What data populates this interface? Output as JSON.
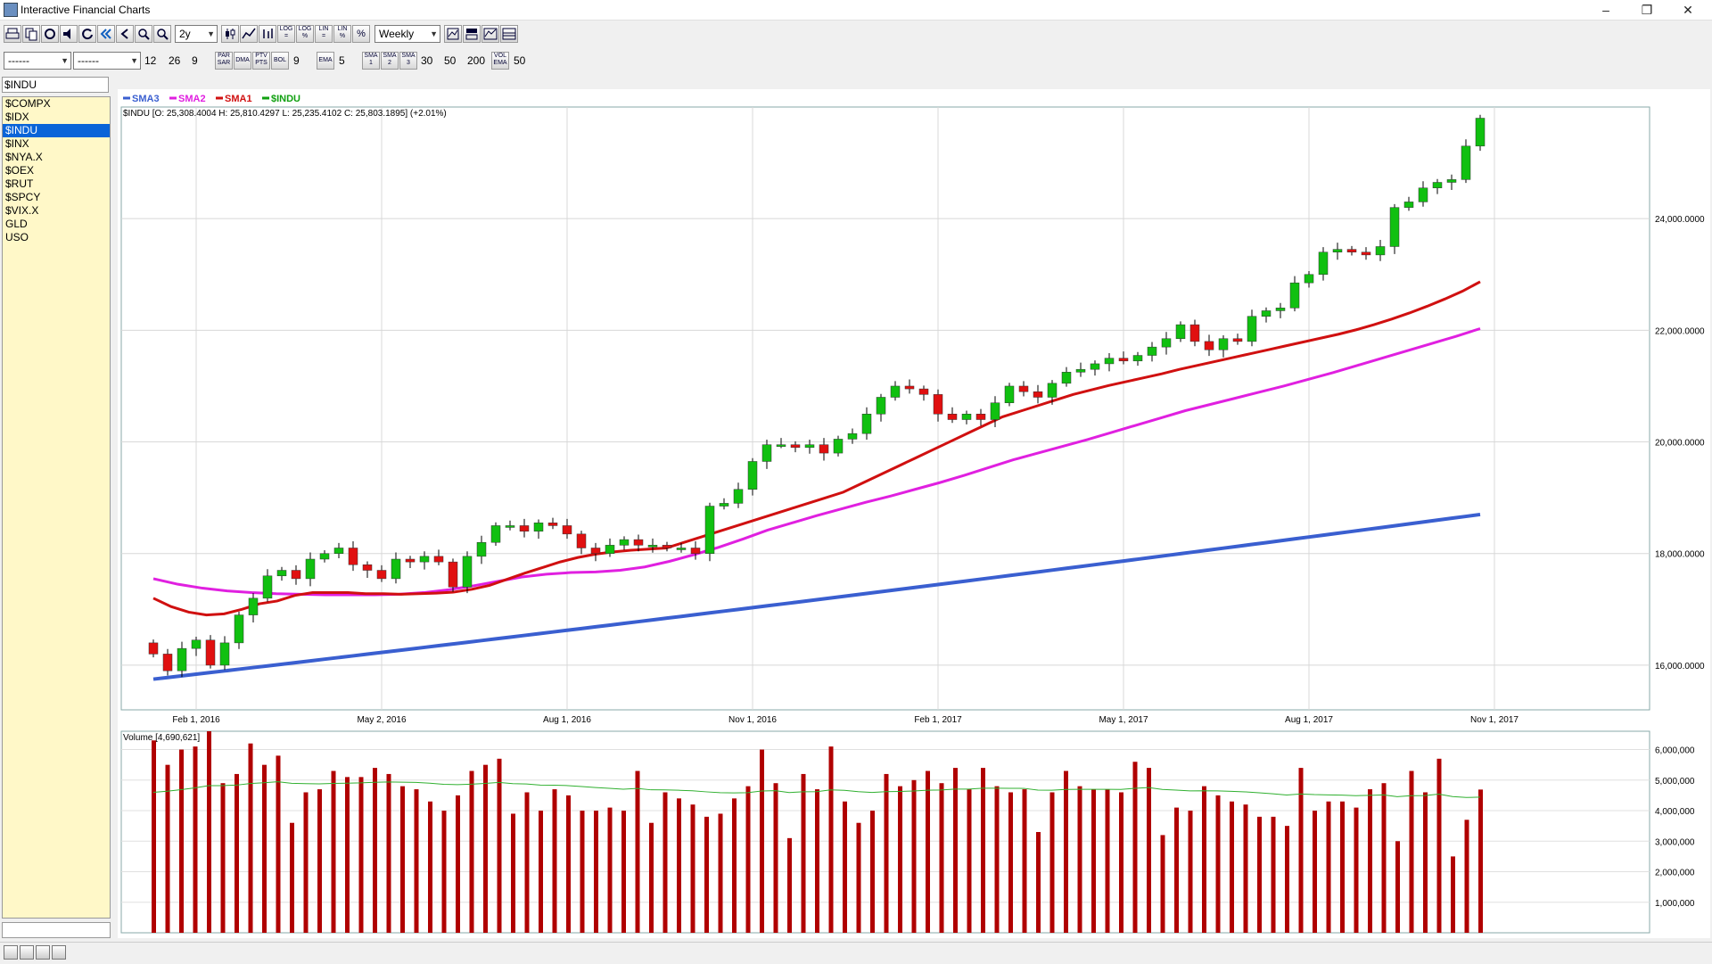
{
  "window": {
    "title": "Interactive Financial Charts"
  },
  "toolbar": {
    "period": "2y",
    "interval": "Weekly",
    "btn_log1": "LOG",
    "btn_log2": "LOG",
    "btn_lin1": "LIN",
    "btn_lin2": "LIN",
    "btn_pct": "%"
  },
  "toolbar2": {
    "combo1": "------",
    "combo2": "------",
    "macd_fast": "12",
    "macd_slow": "26",
    "macd_signal": "9",
    "btn_par": "PAR SAR",
    "btn_dma": "DMA",
    "btn_ptv": "PTV PTS",
    "btn_bol": "BOL",
    "bol_val": "9",
    "btn_ema": "EMA",
    "ema_val": "5",
    "btn_sma1": "SMA 1",
    "btn_sma2": "SMA 2",
    "btn_sma3": "SMA 3",
    "sma1_val": "30",
    "sma2_val": "50",
    "sma3_val": "200",
    "btn_vol": "VOL EMA",
    "vol_val": "50"
  },
  "symbols": {
    "current": "$INDU",
    "list": [
      "$COMPX",
      "$IDX",
      "$INDU",
      "$INX",
      "$NYA.X",
      "$OEX",
      "$RUT",
      "$SPCY",
      "$VIX.X",
      "GLD",
      "USO"
    ],
    "selected": "$INDU"
  },
  "legend": [
    {
      "name": "SMA3",
      "color": "#3a5fd0"
    },
    {
      "name": "SMA2",
      "color": "#e020e0"
    },
    {
      "name": "SMA1",
      "color": "#d01010"
    },
    {
      "name": "$INDU",
      "color": "#10a010"
    }
  ],
  "ohlc_label": "$INDU [O: 25,308.4004  H: 25,810.4297  L: 25,235.4102  C: 25,803.1895] (+2.01%)",
  "volume_label": "Volume [4,690,621]",
  "price_axis": [
    "24,000.0000",
    "22,000.0000",
    "20,000.0000",
    "18,000.0000",
    "16,000.0000"
  ],
  "volume_axis": [
    "6,000,000",
    "5,000,000",
    "4,000,000",
    "3,000,000",
    "2,000,000",
    "1,000,000"
  ],
  "date_axis": [
    "Feb 1, 2016",
    "May 2, 2016",
    "Aug 1, 2016",
    "Nov 1, 2016",
    "Feb 1, 2017",
    "May 1, 2017",
    "Aug 1, 2017",
    "Nov 1, 2017"
  ],
  "chart_data": {
    "type": "candlestick",
    "candle_up_color": "#10c010",
    "candle_down_color": "#e01010",
    "volume_color": "#b00000",
    "ylim": [
      15200,
      26000
    ],
    "vol_ylim": [
      0,
      6600000
    ],
    "x_start": "2016-01-11",
    "x_step_days": 7,
    "closes": [
      16200,
      15900,
      16300,
      16450,
      16000,
      16400,
      16900,
      17200,
      17600,
      17700,
      17550,
      17900,
      18000,
      18100,
      17800,
      17700,
      17550,
      17900,
      17850,
      17950,
      17850,
      17400,
      17950,
      18200,
      18500,
      18500,
      18400,
      18550,
      18500,
      18350,
      18100,
      18000,
      18150,
      18250,
      18150,
      18150,
      18100,
      18100,
      18000,
      18850,
      18900,
      19150,
      19650,
      19950,
      19950,
      19900,
      19950,
      19800,
      20050,
      20150,
      20500,
      20800,
      21000,
      20950,
      20850,
      20500,
      20400,
      20500,
      20400,
      20700,
      21000,
      20900,
      20800,
      21050,
      21250,
      21300,
      21400,
      21500,
      21450,
      21550,
      21700,
      21850,
      22100,
      21800,
      21650,
      21850,
      21800,
      22250,
      22350,
      22400,
      22850,
      23000,
      23400,
      23450,
      23400,
      23350,
      23500,
      24200,
      24300,
      24550,
      24650,
      24700,
      25300,
      25800
    ],
    "sma1": [
      17200,
      17050,
      16950,
      16900,
      16920,
      17000,
      17100,
      17150,
      17250,
      17300,
      17300,
      17300,
      17280,
      17280,
      17270,
      17280,
      17290,
      17310,
      17360,
      17430,
      17540,
      17650,
      17750,
      17850,
      17930,
      17990,
      18030,
      18060,
      18080,
      18100,
      18200,
      18300,
      18400,
      18500,
      18600,
      18700,
      18800,
      18900,
      19000,
      19100,
      19250,
      19400,
      19550,
      19700,
      19850,
      20000,
      20150,
      20300,
      20450,
      20550,
      20650,
      20750,
      20850,
      20930,
      21010,
      21080,
      21150,
      21220,
      21300,
      21370,
      21440,
      21510,
      21580,
      21650,
      21720,
      21790,
      21860,
      21930,
      22010,
      22100,
      22200,
      22310,
      22430,
      22560,
      22700,
      22870
    ],
    "sma2": [
      17550,
      17450,
      17380,
      17330,
      17300,
      17280,
      17270,
      17260,
      17260,
      17260,
      17270,
      17300,
      17350,
      17420,
      17500,
      17580,
      17630,
      17660,
      17670,
      17700,
      17760,
      17860,
      17980,
      18110,
      18260,
      18420,
      18550,
      18680,
      18800,
      18920,
      19030,
      19150,
      19270,
      19400,
      19540,
      19680,
      19800,
      19920,
      20040,
      20170,
      20300,
      20430,
      20560,
      20670,
      20780,
      20890,
      21000,
      21120,
      21240,
      21370,
      21500,
      21630,
      21760,
      21890,
      22030
    ],
    "sma3_range": [
      15750,
      18700
    ],
    "volumes": [
      6300000,
      5500000,
      6000000,
      6100000,
      6600000,
      4900000,
      5200000,
      6200000,
      5500000,
      5800000,
      3600000,
      4600000,
      4700000,
      5300000,
      5100000,
      5100000,
      5400000,
      5200000,
      4800000,
      4700000,
      4300000,
      4000000,
      4500000,
      5300000,
      5500000,
      5700000,
      3900000,
      4600000,
      4000000,
      4700000,
      4500000,
      4000000,
      4000000,
      4100000,
      4000000,
      5300000,
      3600000,
      4600000,
      4400000,
      4200000,
      3800000,
      3900000,
      4400000,
      4800000,
      6000000,
      4900000,
      3100000,
      5200000,
      4700000,
      6100000,
      4300000,
      3600000,
      4000000,
      5200000,
      4800000,
      5000000,
      5300000,
      4900000,
      5400000,
      4700000,
      5400000,
      4800000,
      4600000,
      4700000,
      3300000,
      4600000,
      5300000,
      4800000,
      4700000,
      4700000,
      4600000,
      5600000,
      5400000,
      3200000,
      4100000,
      4000000,
      4800000,
      4500000,
      4300000,
      4200000,
      3800000,
      3800000,
      3500000,
      5400000,
      4000000,
      4300000,
      4300000,
      4100000,
      4700000,
      4900000,
      3000000,
      5300000,
      4600000,
      5700000,
      2500000,
      3700000,
      4690621
    ]
  }
}
